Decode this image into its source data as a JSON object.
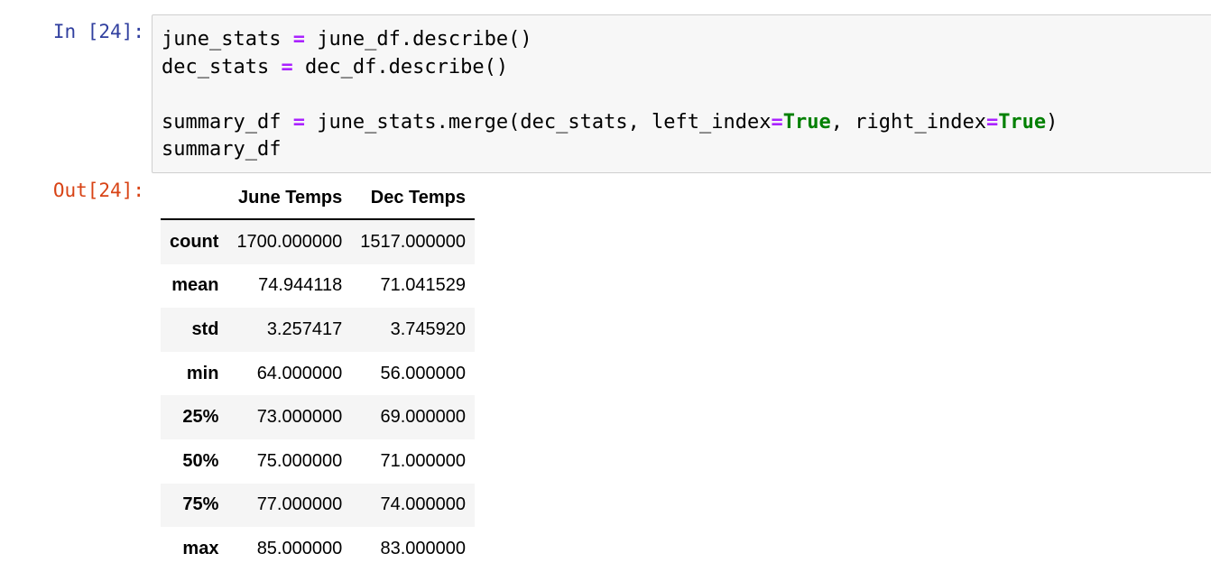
{
  "input_cell": {
    "prompt": "In [24]:",
    "lines": [
      [
        {
          "t": "june_stats ",
          "c": ""
        },
        {
          "t": "=",
          "c": "op"
        },
        {
          "t": " june_df.describe()",
          "c": ""
        }
      ],
      [
        {
          "t": "dec_stats ",
          "c": ""
        },
        {
          "t": "=",
          "c": "op"
        },
        {
          "t": " dec_df.describe()",
          "c": ""
        }
      ],
      [],
      [
        {
          "t": "summary_df ",
          "c": ""
        },
        {
          "t": "=",
          "c": "op"
        },
        {
          "t": " june_stats.merge(dec_stats, left_index",
          "c": ""
        },
        {
          "t": "=",
          "c": "op"
        },
        {
          "t": "True",
          "c": "kw"
        },
        {
          "t": ", right_index",
          "c": ""
        },
        {
          "t": "=",
          "c": "op"
        },
        {
          "t": "True",
          "c": "kw"
        },
        {
          "t": ")",
          "c": ""
        }
      ],
      [
        {
          "t": "summary_df",
          "c": ""
        }
      ]
    ]
  },
  "output_cell": {
    "prompt": "Out[24]:",
    "table": {
      "columns": [
        "",
        "June Temps",
        "Dec Temps"
      ],
      "rows": [
        {
          "index": "count",
          "values": [
            "1700.000000",
            "1517.000000"
          ]
        },
        {
          "index": "mean",
          "values": [
            "74.944118",
            "71.041529"
          ]
        },
        {
          "index": "std",
          "values": [
            "3.257417",
            "3.745920"
          ]
        },
        {
          "index": "min",
          "values": [
            "64.000000",
            "56.000000"
          ]
        },
        {
          "index": "25%",
          "values": [
            "73.000000",
            "69.000000"
          ]
        },
        {
          "index": "50%",
          "values": [
            "75.000000",
            "71.000000"
          ]
        },
        {
          "index": "75%",
          "values": [
            "77.000000",
            "74.000000"
          ]
        },
        {
          "index": "max",
          "values": [
            "85.000000",
            "83.000000"
          ]
        }
      ]
    }
  },
  "colors": {
    "in_prompt": "#303f9f",
    "out_prompt": "#d84315",
    "operator": "#aa22ff",
    "keyword": "#008000",
    "code_background": "#f7f7f7"
  }
}
